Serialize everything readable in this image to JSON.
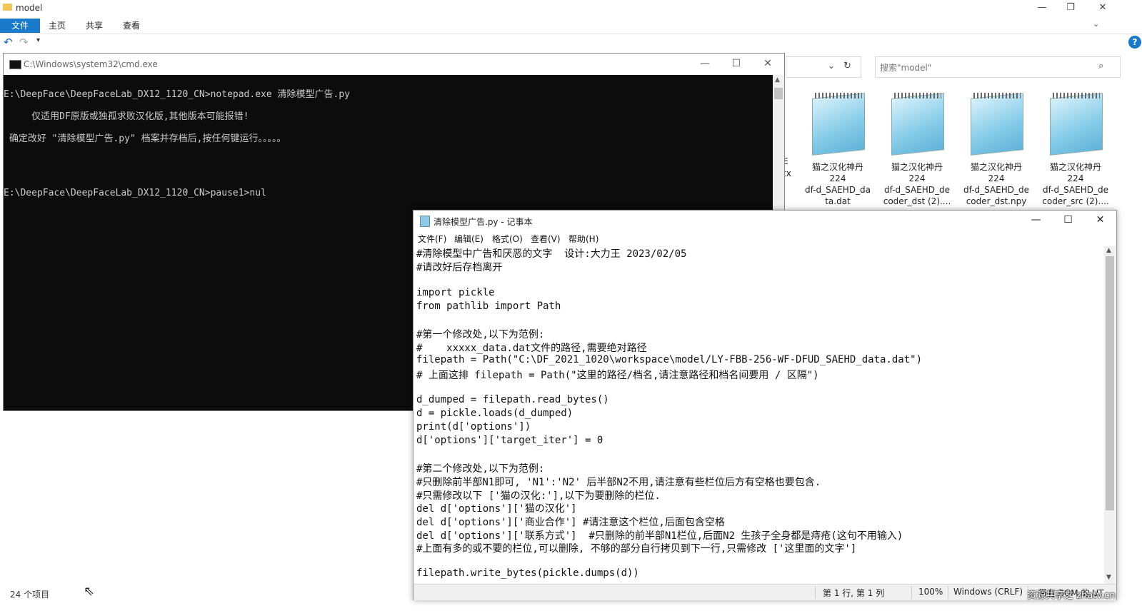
{
  "explorer": {
    "title": "model",
    "tabs": [
      "文件",
      "主页",
      "共享",
      "查看"
    ],
    "search_placeholder": "搜索\"model\"",
    "status_count": "24 个项目",
    "files": [
      {
        "name_lines": [
          "猫之汉化神丹",
          "224",
          "df-d_SAEHD_da",
          "ta.dat"
        ]
      },
      {
        "name_lines": [
          "猫之汉化神丹",
          "224",
          "df-d_SAEHD_de",
          "coder_dst (2)...."
        ]
      },
      {
        "name_lines": [
          "猫之汉化神丹",
          "224",
          "df-d_SAEHD_de",
          "coder_dst.npy"
        ]
      },
      {
        "name_lines": [
          "猫之汉化神丹",
          "224",
          "df-d_SAEHD_de",
          "coder_src (2)...."
        ]
      }
    ],
    "partial_text": [
      "E",
      "tx"
    ]
  },
  "cmd": {
    "title": "C:\\Windows\\system32\\cmd.exe",
    "lines": [
      "E:\\DeepFace\\DeepFaceLab_DX12_1120_CN>notepad.exe 清除模型广告.py",
      "     仅适用DF原版或独孤求败汉化版,其他版本可能报错!",
      " 确定改好 \"清除模型广告.py\" 档案并存档后,按任何键运行。。。。。",
      "",
      "",
      "E:\\DeepFace\\DeepFaceLab_DX12_1120_CN>pause1>nul"
    ]
  },
  "notepad": {
    "title": "清除模型广告.py - 记事本",
    "menu": [
      "文件(F)",
      "编辑(E)",
      "格式(O)",
      "查看(V)",
      "帮助(H)"
    ],
    "lines": [
      "#清除模型中广告和厌恶的文字  设计:大力王 2023/02/05",
      "#请改好后存档离开",
      "",
      "import pickle",
      "from pathlib import Path",
      "",
      "#第一个修改处,以下为范例:",
      "#    xxxxx_data.dat文件的路径,需要绝对路径",
      "filepath = Path(\"C:\\DF_2021_1020\\workspace\\model/LY-FBB-256-WF-DFUD_SAEHD_data.dat\")",
      "# 上面这排 filepath = Path(\"这里的路径/档名,请注意路径和档名间要用 / 区隔\")",
      "",
      "d_dumped = filepath.read_bytes()",
      "d = pickle.loads(d_dumped)",
      "print(d['options'])",
      "d['options']['target_iter'] = 0",
      "",
      "#第二个修改处,以下为范例:",
      "#只删除前半部N1即可, 'N1':'N2' 后半部N2不用,请注意有些栏位后方有空格也要包含.",
      "#只需修改以下 ['猫の汉化:'],以下为要删除的栏位.",
      "del d['options']['猫の汉化']",
      "del d['options']['商业合作'] #请注意这个栏位,后面包含空格",
      "del d['options']['联系方式']  #只删除的前半部N1栏位,后面N2 生孩子全身都是痔疮(这句不用输入)",
      "#上面有多的或不要的栏位,可以删除, 不够的部分自行拷贝到下一行,只需修改 ['这里面的文字']",
      "",
      "filepath.write_bytes(pickle.dumps(d))"
    ],
    "status": {
      "position": "第 1 行, 第 1 列",
      "zoom": "100%",
      "line_ending": "Windows (CRLF)",
      "encoding": "带有 BOM 的 UT"
    }
  },
  "watermark": "资源共享之 zhatv.cn"
}
